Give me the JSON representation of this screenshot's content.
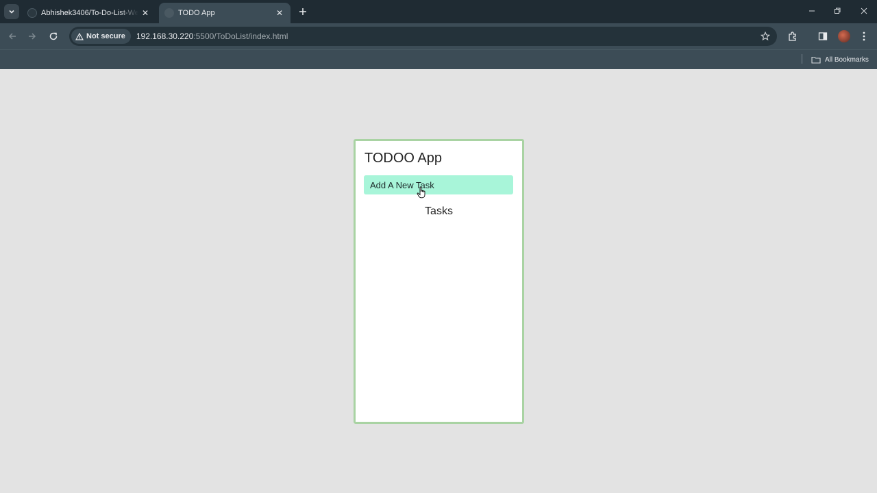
{
  "browser": {
    "tabs": [
      {
        "title": "Abhishek3406/To-Do-List-Web",
        "active": false
      },
      {
        "title": "TODO App",
        "active": true
      }
    ],
    "security_label": "Not secure",
    "url_host": "192.168.30.220",
    "url_path": ":5500/ToDoList/index.html",
    "bookmarks_label": "All Bookmarks"
  },
  "app": {
    "title": "TODOO App",
    "input_placeholder": "Add A New Task",
    "tasks_heading": "Tasks"
  },
  "colors": {
    "card_border": "#a9d3a3",
    "input_bg": "#a8f5d9",
    "page_bg": "#e3e3e3"
  }
}
